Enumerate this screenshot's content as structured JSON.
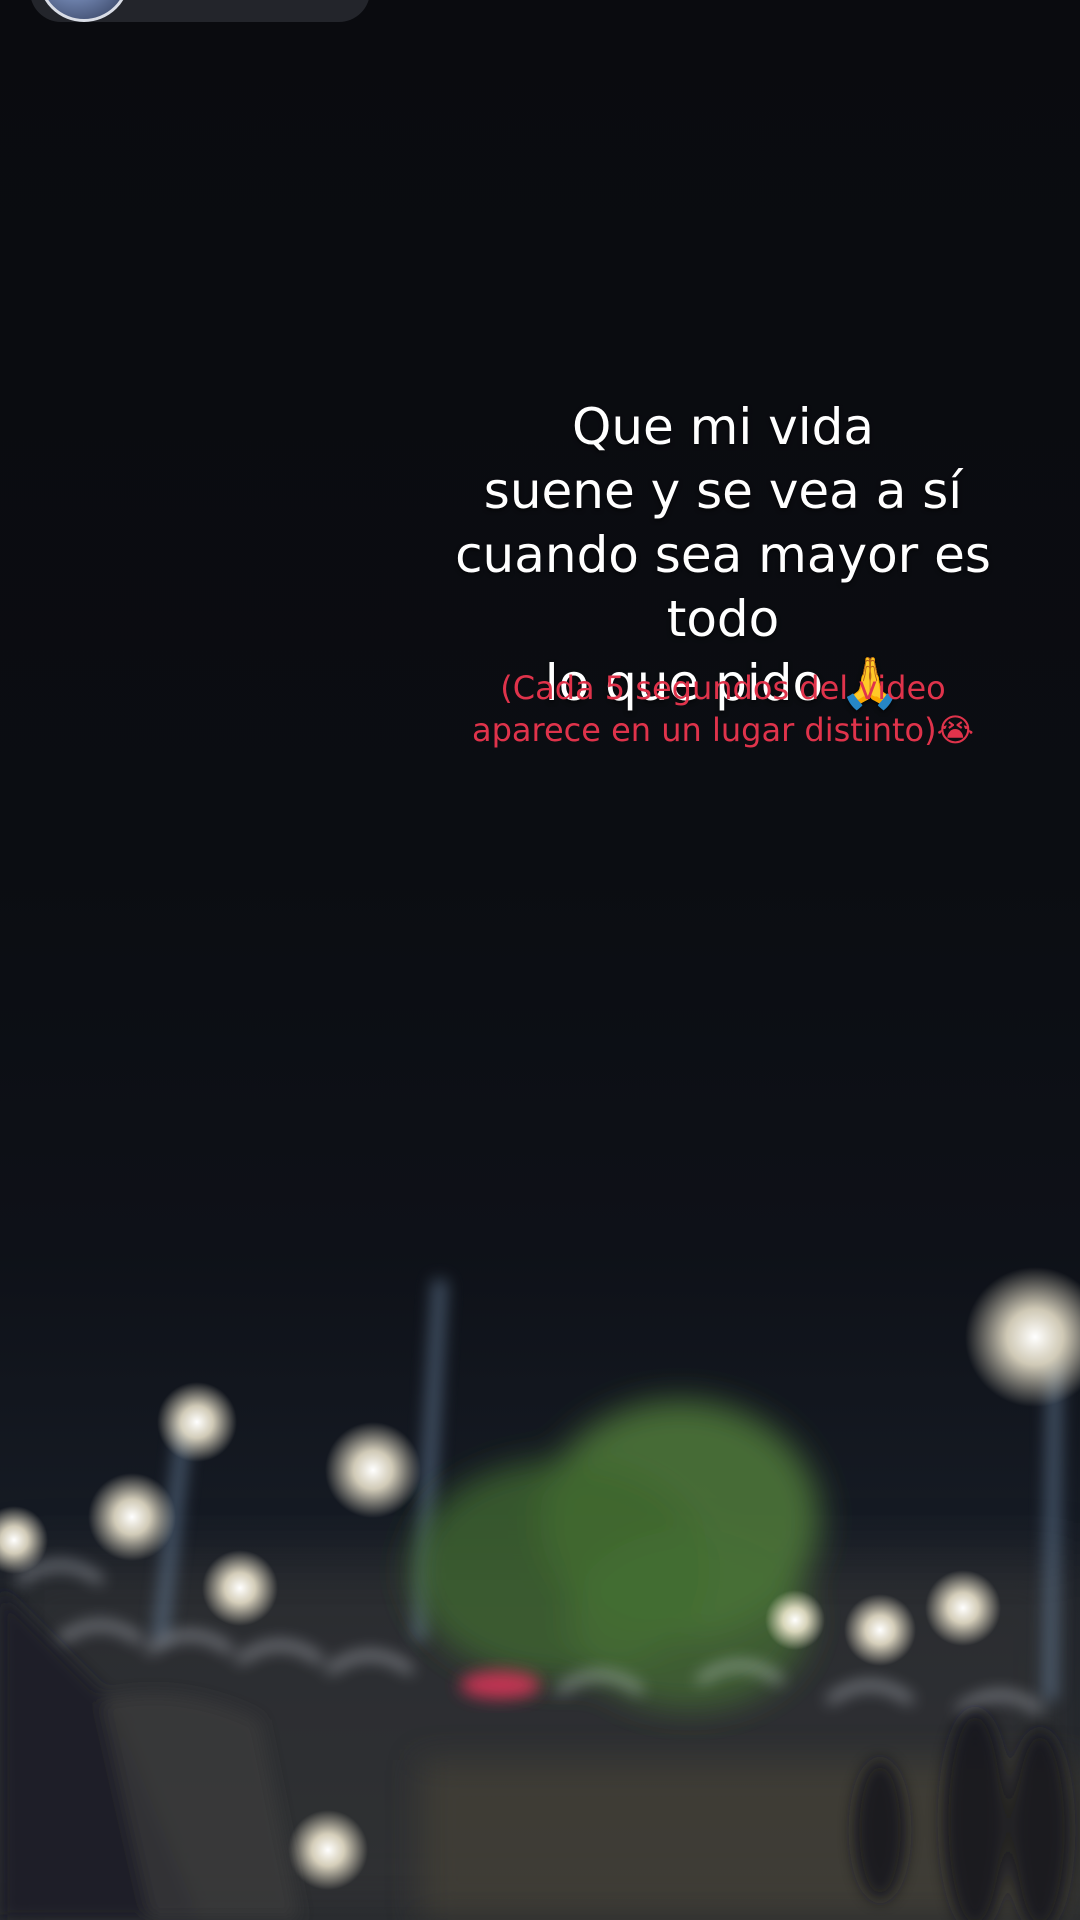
{
  "overlay": {
    "caption_main": "Que mi vida\nsuene y se vea a sí\ncuando sea mayor es todo\nlo que pido 🙏",
    "caption_sub": "(Cada 5 segundos del video\naparece en un lugar distinto)😭"
  },
  "colors": {
    "caption_main": "#ffffff",
    "caption_sub": "#e0334b",
    "background": "#0c0d11"
  },
  "icons": {
    "avatar": "profile-avatar"
  }
}
